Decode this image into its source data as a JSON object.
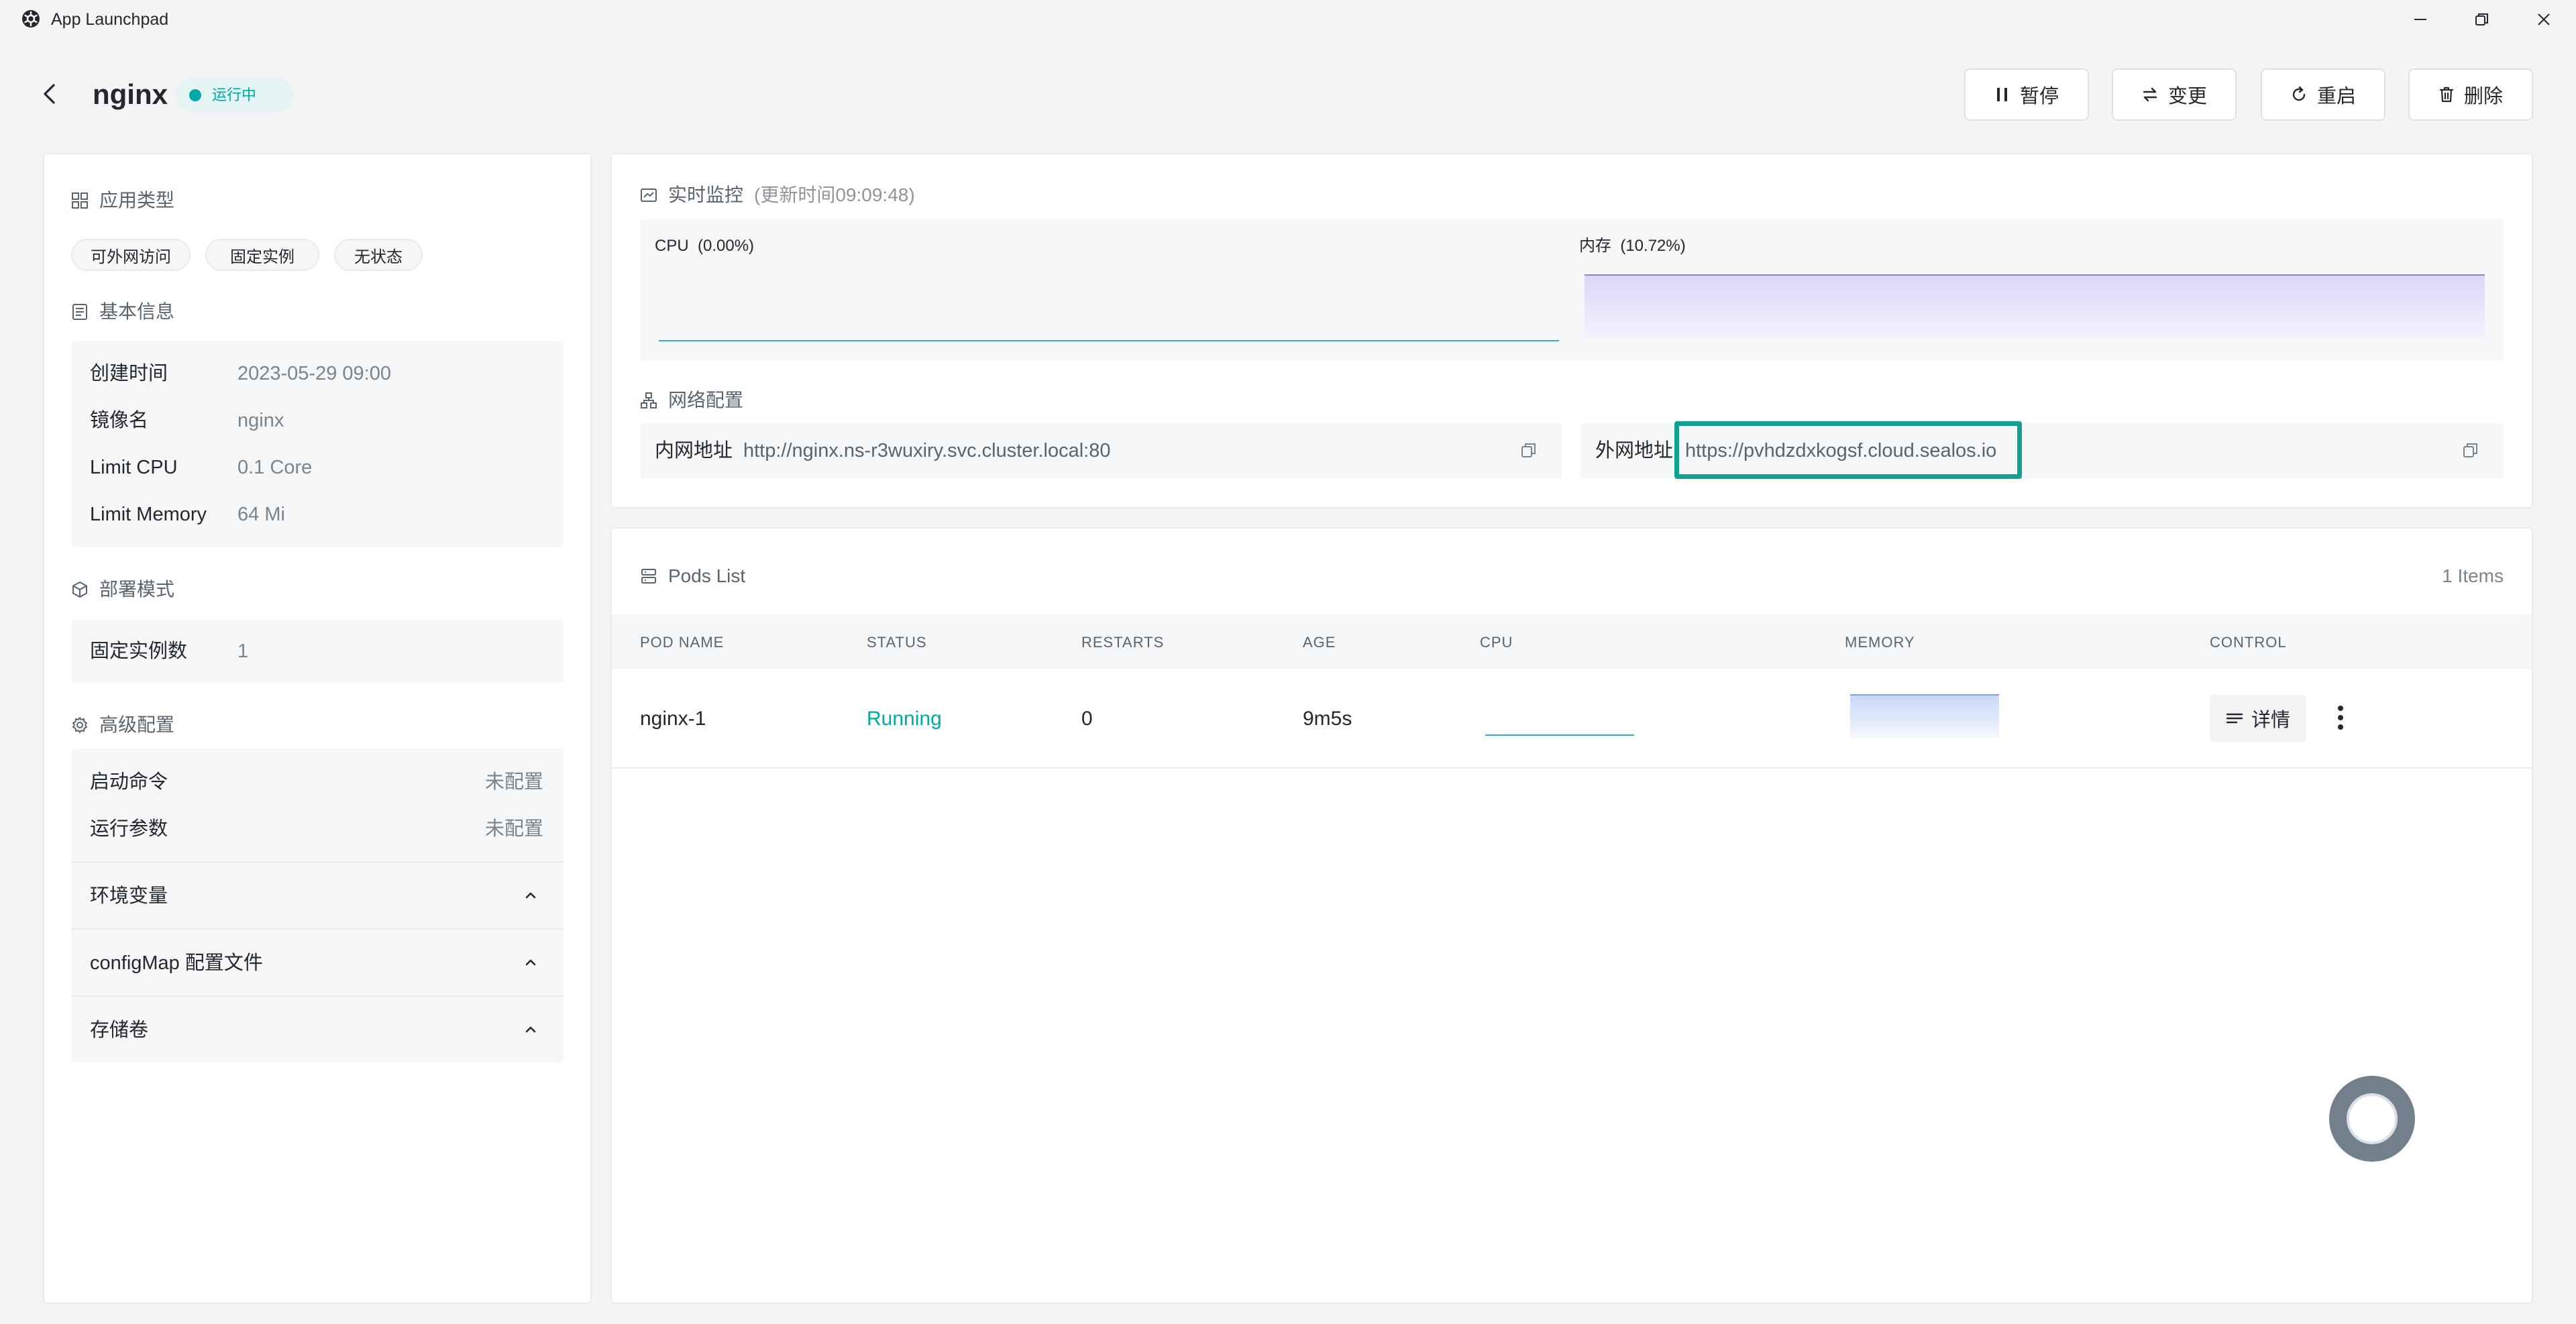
{
  "window": {
    "title": "App Launchpad"
  },
  "header": {
    "app_name": "nginx",
    "status": "运行中",
    "buttons": {
      "pause": "暂停",
      "change": "变更",
      "restart": "重启",
      "delete": "删除"
    }
  },
  "sidebar": {
    "app_type": {
      "title": "应用类型",
      "tags": [
        "可外网访问",
        "固定实例",
        "无状态"
      ]
    },
    "basic_info": {
      "title": "基本信息",
      "rows": [
        {
          "label": "创建时间",
          "value": "2023-05-29 09:00"
        },
        {
          "label": "镜像名",
          "value": "nginx"
        },
        {
          "label": "Limit CPU",
          "value": "0.1 Core"
        },
        {
          "label": "Limit Memory",
          "value": "64 Mi"
        }
      ]
    },
    "deploy_mode": {
      "title": "部署模式",
      "label": "固定实例数",
      "value": "1"
    },
    "advanced": {
      "title": "高级配置",
      "rows": [
        {
          "label": "启动命令",
          "value": "未配置"
        },
        {
          "label": "运行参数",
          "value": "未配置"
        }
      ],
      "collapsibles": [
        "环境变量",
        "configMap 配置文件",
        "存储卷"
      ]
    }
  },
  "monitor": {
    "title": "实时监控",
    "updated": "(更新时间09:09:48)",
    "cpu_label": "CPU",
    "cpu_value": "(0.00%)",
    "mem_label": "内存",
    "mem_value": "(10.72%)",
    "cpu_percent": 0.0,
    "mem_percent": 10.72
  },
  "network": {
    "title": "网络配置",
    "internal_label": "内网地址",
    "internal_url": "http://nginx.ns-r3wuxiry.svc.cluster.local:80",
    "external_label": "外网地址",
    "external_url": "https://pvhdzdxkogsf.cloud.sealos.io"
  },
  "pods": {
    "title": "Pods List",
    "count": "1 Items",
    "columns": [
      "POD NAME",
      "STATUS",
      "RESTARTS",
      "AGE",
      "CPU",
      "MEMORY",
      "CONTROL"
    ],
    "rows": [
      {
        "name": "nginx-1",
        "status": "Running",
        "restarts": "0",
        "age": "9m5s",
        "detail": "详情"
      }
    ]
  },
  "colors": {
    "accent": "#00a9a6",
    "highlight_border": "#10a28f",
    "cpu_line": "#36a8d8",
    "mem_line": "#8b80dc",
    "mem_fill": "#e8e4fa"
  }
}
